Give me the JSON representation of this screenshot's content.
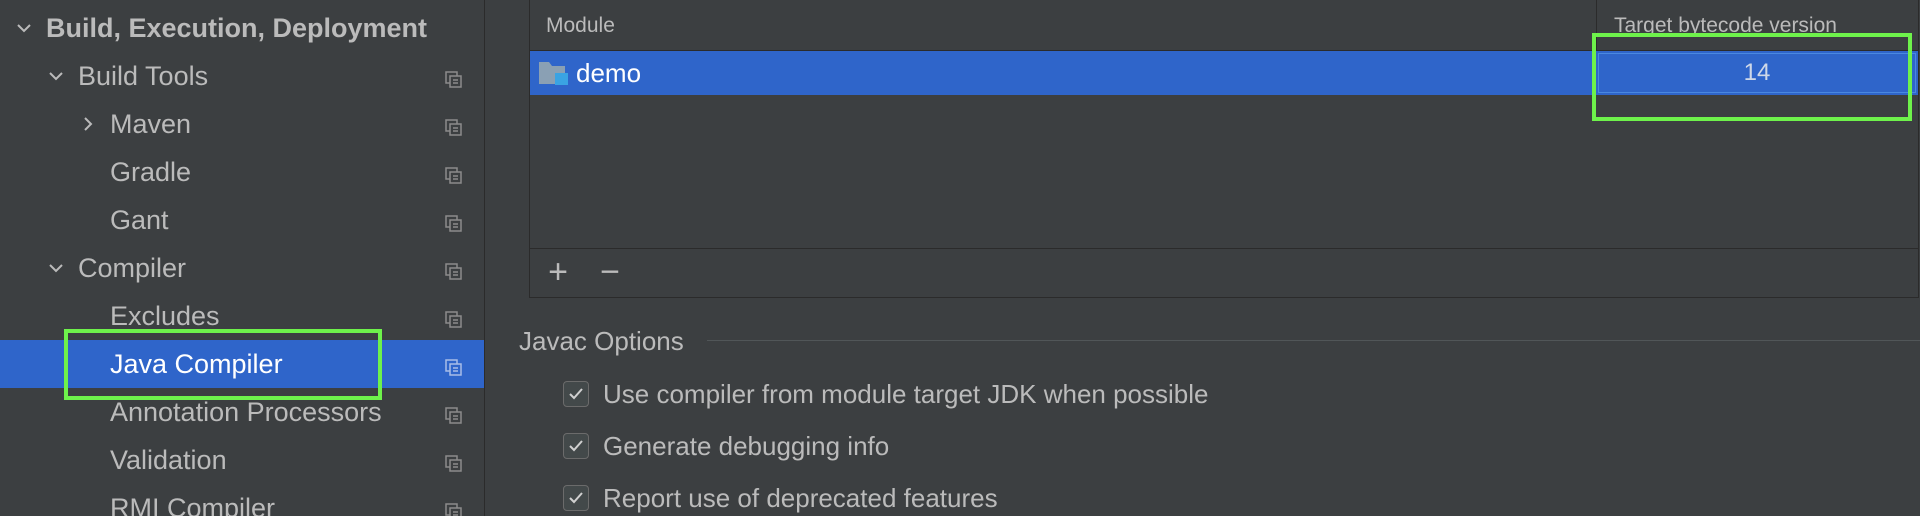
{
  "sidebar": {
    "items": [
      {
        "label": "Build, Execution, Deployment",
        "chevron": "down"
      },
      {
        "label": "Build Tools",
        "chevron": "down"
      },
      {
        "label": "Maven",
        "chevron": "right"
      },
      {
        "label": "Gradle"
      },
      {
        "label": "Gant"
      },
      {
        "label": "Compiler",
        "chevron": "down"
      },
      {
        "label": "Excludes"
      },
      {
        "label": "Java Compiler",
        "selected": true
      },
      {
        "label": "Annotation Processors"
      },
      {
        "label": "Validation"
      },
      {
        "label": "RMI Compiler"
      }
    ]
  },
  "module_table": {
    "columns": [
      "Module",
      "Target bytecode version"
    ],
    "rows": [
      {
        "module": "demo",
        "target": "14",
        "selected": true
      }
    ],
    "add_label": "+",
    "remove_label": "−"
  },
  "javac_options": {
    "title": "Javac Options",
    "options": [
      {
        "label": "Use compiler from module target JDK when possible",
        "checked": true
      },
      {
        "label": "Generate debugging info",
        "checked": true
      },
      {
        "label": "Report use of deprecated features",
        "checked": true
      }
    ]
  },
  "colors": {
    "background": "#3c3f41",
    "selection": "#2f65ca",
    "highlight": "#6ef24b",
    "text": "#bbbbbb"
  }
}
